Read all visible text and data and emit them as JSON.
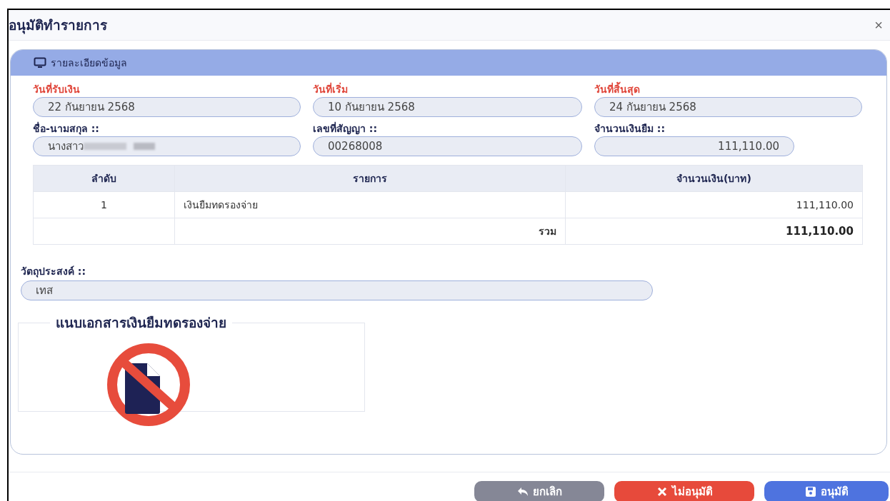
{
  "window": {
    "title": "อนุมัติทำรายการ",
    "close": "×"
  },
  "card": {
    "title": "รายละเอียดข้อมูล"
  },
  "fields": [
    {
      "label": "วันที่รับเงิน",
      "value": "22 กันยายน 2568",
      "required": true,
      "kind": "text",
      "redacted": false
    },
    {
      "label": "วันที่เริ่ม",
      "value": "10 กันยายน 2568",
      "required": true,
      "kind": "text",
      "redacted": false
    },
    {
      "label": "วันที่สิ้นสุด",
      "value": "24 กันยายน 2568",
      "required": true,
      "kind": "text",
      "redacted": false
    },
    {
      "label": "ชื่อ-นามสกุล ::",
      "value": "นางสาว",
      "required": false,
      "kind": "text",
      "redacted": true
    },
    {
      "label": "เลขที่สัญญา ::",
      "value": "00268008",
      "required": false,
      "kind": "text",
      "redacted": false
    },
    {
      "label": "จำนวนเงินยืม ::",
      "value": "111,110.00",
      "required": false,
      "kind": "amount",
      "redacted": false
    }
  ],
  "table": {
    "columns": [
      "ลำดับ",
      "รายการ",
      "จำนวนเงิน(บาท)"
    ],
    "rows": [
      {
        "no": "1",
        "item": "เงินยืมทดรองจ่าย",
        "amount": "111,110.00"
      }
    ],
    "total": {
      "label": "รวม",
      "amount": "111,110.00"
    }
  },
  "purpose": {
    "label": "วัตถุประสงค์ ::",
    "value": "เทส"
  },
  "attachment": {
    "legend": "แนบเอกสารเงินยืมทดรองจ่าย"
  },
  "buttons": [
    {
      "label": "ยกเลิก",
      "kind": "cancel"
    },
    {
      "label": "ไม่อนุมัติ",
      "kind": "reject"
    },
    {
      "label": "อนุมัติ",
      "kind": "approve"
    }
  ]
}
